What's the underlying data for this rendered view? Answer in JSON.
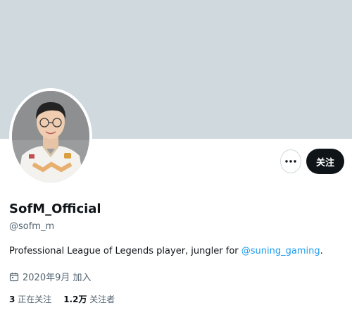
{
  "profile": {
    "display_name": "SofM_Official",
    "handle": "@sofm_m",
    "bio_text": "Professional League of Legends player, jungler for ",
    "bio_link": "@suning_gaming",
    "bio_end": ".",
    "joined": "2020年9月 加入",
    "following_count": "3",
    "following_label": "正在关注",
    "followers_count": "1.2万",
    "followers_label": "关注者"
  },
  "actions": {
    "follow_label": "关注",
    "more_icon": "more-horizontal-icon"
  },
  "colors": {
    "banner": "#cfd9de",
    "link": "#1d9bf0",
    "follow_bg": "#0f1419",
    "secondary_text": "#536471"
  }
}
